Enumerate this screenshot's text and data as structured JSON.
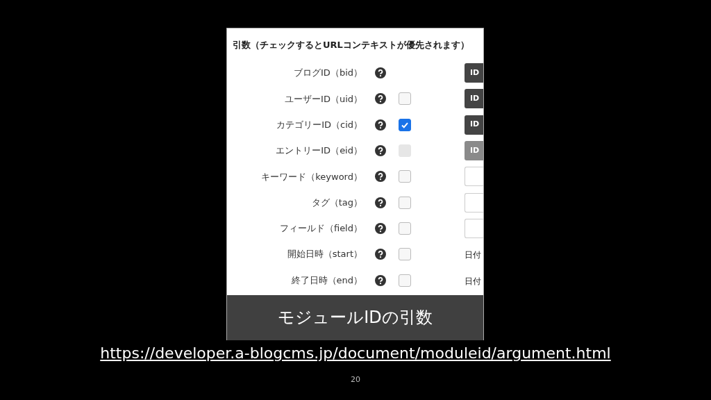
{
  "screenshot": {
    "title": "引数（チェックするとURLコンテキストが優先されます）",
    "rows": [
      {
        "label": "ブログID（bid）",
        "control": {
          "kind": "button",
          "text": "ID",
          "disabled": false
        }
      },
      {
        "label": "ユーザーID（uid）",
        "checkbox": {
          "checked": false,
          "disabled": false
        },
        "control": {
          "kind": "button",
          "text": "ID",
          "disabled": false
        }
      },
      {
        "label": "カテゴリーID（cid）",
        "checkbox": {
          "checked": true,
          "disabled": false
        },
        "control": {
          "kind": "button",
          "text": "ID",
          "disabled": false
        }
      },
      {
        "label": "エントリーID（eid）",
        "checkbox": {
          "checked": false,
          "disabled": true
        },
        "control": {
          "kind": "button",
          "text": "ID",
          "disabled": true
        }
      },
      {
        "label": "キーワード（keyword）",
        "checkbox": {
          "checked": false,
          "disabled": false
        },
        "control": {
          "kind": "input"
        }
      },
      {
        "label": "タグ（tag）",
        "checkbox": {
          "checked": false,
          "disabled": false
        },
        "control": {
          "kind": "input"
        }
      },
      {
        "label": "フィールド（field）",
        "checkbox": {
          "checked": false,
          "disabled": false
        },
        "control": {
          "kind": "input"
        }
      },
      {
        "label": "開始日時（start）",
        "checkbox": {
          "checked": false,
          "disabled": false
        },
        "control": {
          "kind": "text",
          "text": "日付"
        }
      },
      {
        "label": "終了日時（end）",
        "checkbox": {
          "checked": false,
          "disabled": false
        },
        "control": {
          "kind": "text",
          "text": "日付"
        }
      }
    ]
  },
  "caption": "モジュールIDの引数",
  "link": "https://developer.a-blogcms.jp/document/moduleid/argument.html",
  "page_number": "20"
}
